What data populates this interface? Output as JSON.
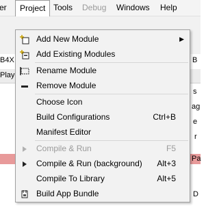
{
  "menubar": {
    "items": [
      {
        "label": "er"
      },
      {
        "label": "Project"
      },
      {
        "label": "Tools"
      },
      {
        "label": "Debug"
      },
      {
        "label": "Windows"
      },
      {
        "label": "Help"
      }
    ]
  },
  "background": {
    "toolbar_text": "B4X",
    "tab_text": "Playe",
    "right_fragments": [
      "B",
      "s",
      "ag",
      "e",
      "r",
      "Pa",
      "D"
    ]
  },
  "project_menu": {
    "items": [
      {
        "label": "Add New Module",
        "icon": "add-new-module-icon",
        "has_submenu": true
      },
      {
        "label": "Add Existing Modules",
        "icon": "add-existing-modules-icon"
      },
      {
        "label": "Rename Module",
        "icon": "rename-module-icon"
      },
      {
        "label": "Remove Module",
        "icon": "remove-module-icon"
      },
      {
        "label": "Choose Icon"
      },
      {
        "label": "Build Configurations",
        "shortcut": "Ctrl+B"
      },
      {
        "label": "Manifest Editor"
      },
      {
        "label": "Compile & Run",
        "shortcut": "F5",
        "icon": "play-icon",
        "disabled": true
      },
      {
        "label": "Compile & Run (background)",
        "shortcut": "Alt+3",
        "icon": "play-icon"
      },
      {
        "label": "Compile To Library",
        "shortcut": "Alt+5"
      },
      {
        "label": "Build App Bundle",
        "icon": "bundle-icon"
      }
    ]
  }
}
